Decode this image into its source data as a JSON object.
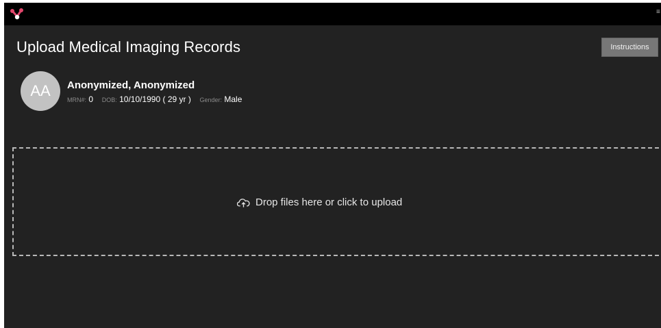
{
  "header": {
    "title": "Upload Medical Imaging Records",
    "instructions_label": "Instructions",
    "logo_icon": "app-logo-icon",
    "colors": {
      "accent": "#e0466b",
      "background": "#222222",
      "topbar": "#000000"
    }
  },
  "patient": {
    "initials": "AA",
    "name": "Anonymized, Anonymized",
    "mrn_label": "MRN#:",
    "mrn_value": "0",
    "dob_label": "DOB:",
    "dob_value": "10/10/1990 ( 29 yr )",
    "gender_label": "Gender:",
    "gender_value": "Male"
  },
  "dropzone": {
    "icon": "upload-cloud-icon",
    "label": "Drop files here or click to upload"
  }
}
